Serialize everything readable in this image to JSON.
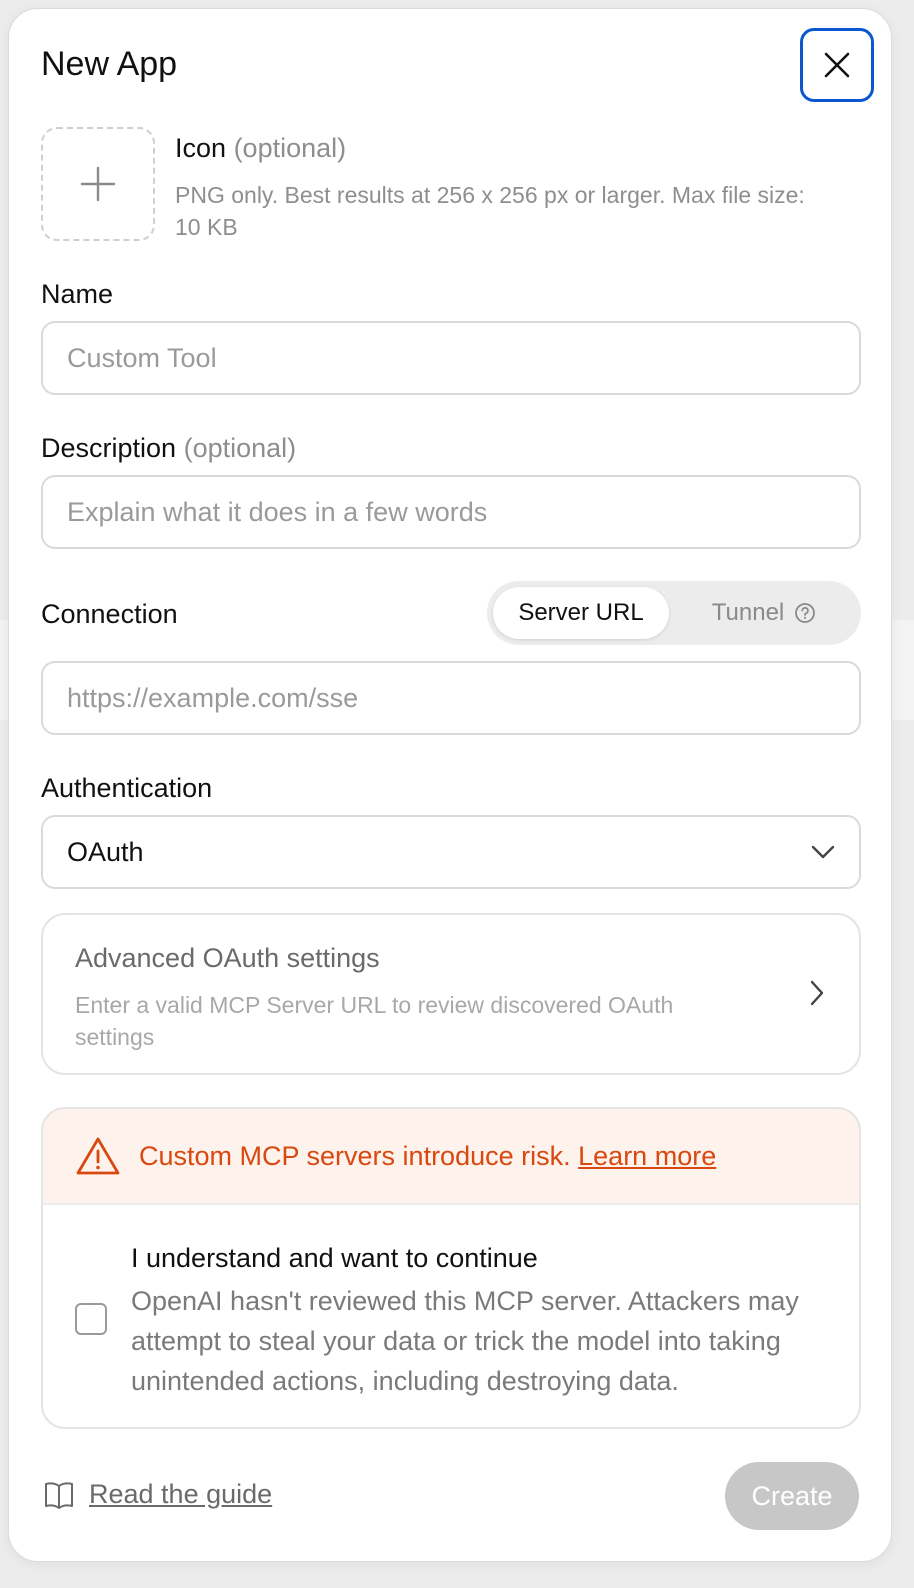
{
  "modal": {
    "title": "New App",
    "close_icon": "close-icon"
  },
  "icon_upload": {
    "title": "Icon",
    "optional": "(optional)",
    "help": "PNG only. Best results at 256 x 256 px or larger. Max file size: 10 KB",
    "icon": "plus-icon"
  },
  "name": {
    "label": "Name",
    "placeholder": "Custom Tool",
    "value": ""
  },
  "description": {
    "label": "Description",
    "optional": "(optional)",
    "placeholder": "Explain what it does in a few words",
    "value": ""
  },
  "connection": {
    "label": "Connection",
    "options": [
      "Server URL",
      "Tunnel"
    ],
    "selected": "Server URL",
    "tunnel_help_icon": "help-circle-icon",
    "placeholder": "https://example.com/sse",
    "value": ""
  },
  "authentication": {
    "label": "Authentication",
    "selected": "OAuth",
    "chevron_icon": "chevron-down-icon"
  },
  "advanced": {
    "title": "Advanced OAuth settings",
    "subtitle": "Enter a valid MCP Server URL to review discovered OAuth settings",
    "chevron_icon": "chevron-right-icon"
  },
  "warning": {
    "text": "Custom MCP servers introduce risk.",
    "link": "Learn more",
    "icon": "warning-triangle-icon",
    "color": "#d9480f",
    "background": "#fdf2ec"
  },
  "acknowledge": {
    "title": "I understand and want to continue",
    "body": "OpenAI hasn't reviewed this MCP server. Attackers may attempt to steal your data or trick the model into taking unintended actions, including destroying data.",
    "checked": false
  },
  "footer": {
    "guide_label": "Read the guide",
    "guide_icon": "book-icon",
    "create_label": "Create",
    "create_enabled": false
  },
  "colors": {
    "focus_ring": "#0b57d0",
    "disabled_button": "#c7c7c7"
  }
}
